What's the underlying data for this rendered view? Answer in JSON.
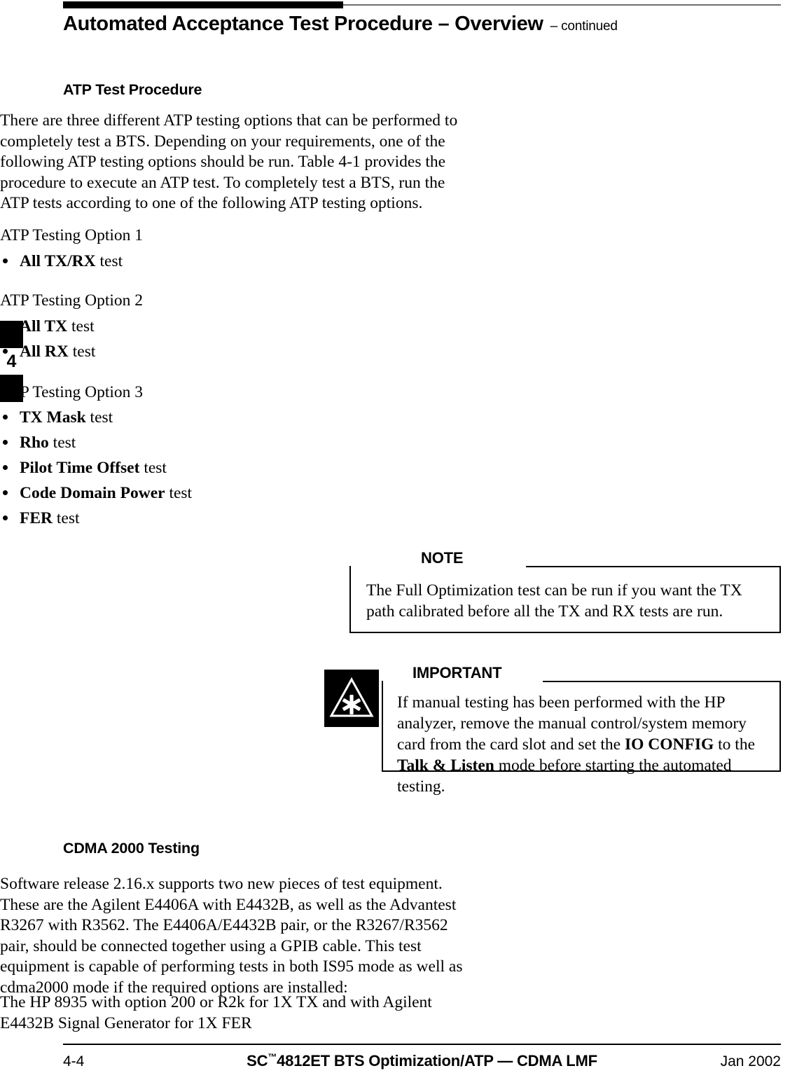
{
  "header": {
    "title": "Automated Acceptance Test Procedure – Overview",
    "continued": "– continued"
  },
  "chapter_tab": {
    "number": "4"
  },
  "sections": {
    "atp_test_procedure": {
      "heading": "ATP Test Procedure",
      "intro": "There are three different ATP testing options that can be performed to completely test a BTS. Depending on your requirements, one of the following ATP testing options should be run. Table 4-1 provides the procedure to execute an ATP test. To completely test a BTS, run the ATP tests according to one of the following ATP testing options.",
      "option1": {
        "title": "ATP Testing Option 1",
        "items": [
          {
            "name": "All TX/RX",
            "suffix": " test"
          }
        ]
      },
      "option2": {
        "title": "ATP Testing Option 2",
        "items": [
          {
            "name": "All TX",
            "suffix": " test"
          },
          {
            "name": "All RX",
            "suffix": " test"
          }
        ]
      },
      "option3": {
        "title": "ATP Testing Option 3",
        "items": [
          {
            "name": "TX Mask",
            "suffix": " test"
          },
          {
            "name": "Rho",
            "suffix": " test"
          },
          {
            "name": "Pilot Time Offset",
            "suffix": " test"
          },
          {
            "name": "Code Domain Power",
            "suffix": " test"
          },
          {
            "name": "FER",
            "suffix": " test"
          }
        ]
      }
    },
    "cdma_2000_testing": {
      "heading": "CDMA 2000 Testing",
      "para1": "Software release 2.16.x supports two new pieces of test equipment. These are the Agilent E4406A with E4432B, as well as the Advantest R3267 with R3562. The E4406A/E4432B pair, or the R3267/R3562 pair, should be connected together using a GPIB cable. This test equipment is capable of performing tests in both IS95 mode as well as cdma2000 mode if the required options are installed:",
      "para2": "The HP 8935 with option 200 or R2k  for 1X TX and with Agilent E4432B Signal Generator for 1X FER"
    }
  },
  "callouts": {
    "note": {
      "label": "NOTE",
      "text": "The Full Optimization test can be run if you want the TX path calibrated before all the TX and RX tests are run."
    },
    "important": {
      "label": "IMPORTANT",
      "icon": "warning-triangle-asterisk-icon",
      "text_part1": "If manual testing has been performed with the HP analyzer, remove the manual control/system memory card from the card slot and set the ",
      "bold1": "IO CONFIG",
      "text_part2": " to the ",
      "bold2": "Talk & Listen",
      "text_part3": " mode before starting the automated testing."
    }
  },
  "footer": {
    "page_number": "4-4",
    "title_prefix": "SC",
    "title_trademark": "™",
    "title_suffix": "4812ET BTS Optimization/ATP — CDMA LMF",
    "date": "Jan 2002"
  },
  "colors": {
    "ink": "#000000",
    "rule_gray": "#6e6e70",
    "page": "#ffffff"
  }
}
